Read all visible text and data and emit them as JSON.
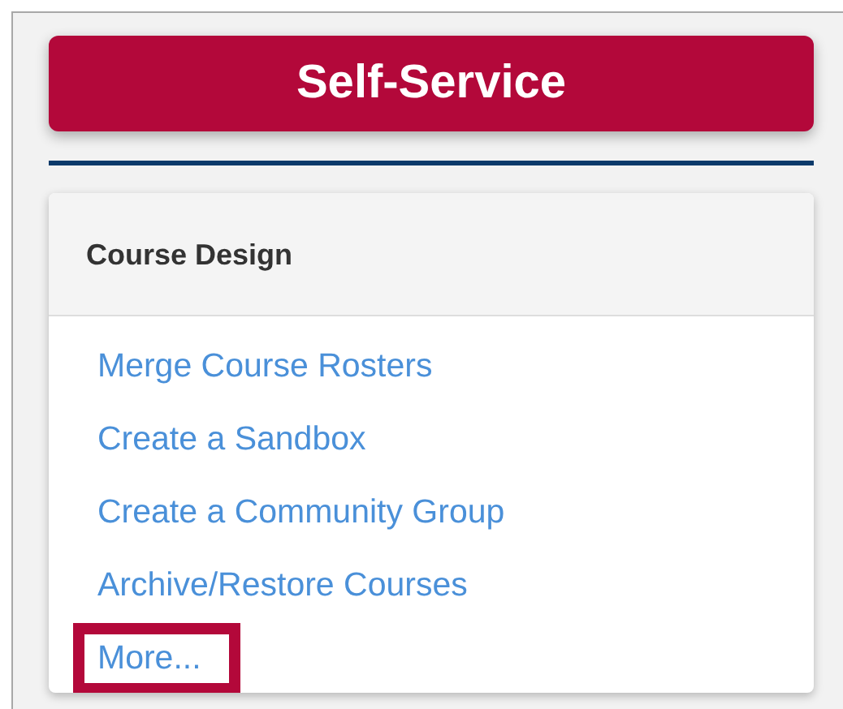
{
  "header_button": {
    "label": "Self-Service"
  },
  "panel": {
    "title": "Course Design",
    "links": [
      {
        "label": "Merge Course Rosters",
        "highlighted": false
      },
      {
        "label": "Create a Sandbox",
        "highlighted": false
      },
      {
        "label": "Create a Community Group",
        "highlighted": false
      },
      {
        "label": "Archive/Restore Courses",
        "highlighted": false
      },
      {
        "label": "More...",
        "highlighted": true
      }
    ]
  }
}
